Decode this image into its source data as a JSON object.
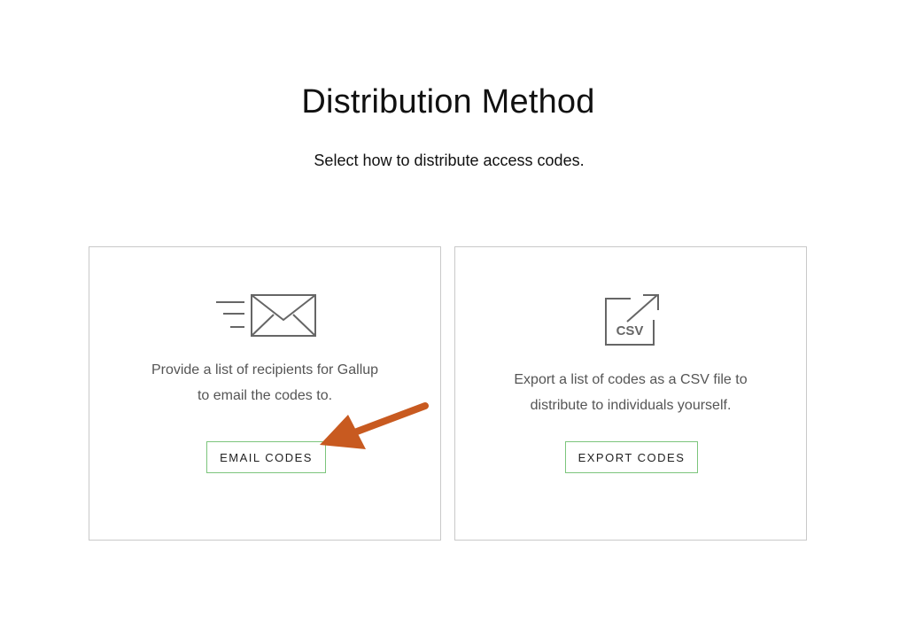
{
  "header": {
    "title": "Distribution Method",
    "subtitle": "Select how to distribute access codes."
  },
  "cards": [
    {
      "icon": "envelope-speed-icon",
      "description_lines": [
        "Provide a list of recipients for Gallup",
        "to email the codes to."
      ],
      "button_label": "EMAIL CODES"
    },
    {
      "icon": "csv-export-icon",
      "icon_text": "CSV",
      "description_lines": [
        "Export a list of codes as a CSV file to",
        "distribute to individuals yourself."
      ],
      "button_label": "EXPORT CODES"
    }
  ],
  "colors": {
    "button_border": "#7cc57c",
    "card_border": "#c9c9c9",
    "icon_stroke": "#666666",
    "annotation_arrow": "#c85a20"
  }
}
